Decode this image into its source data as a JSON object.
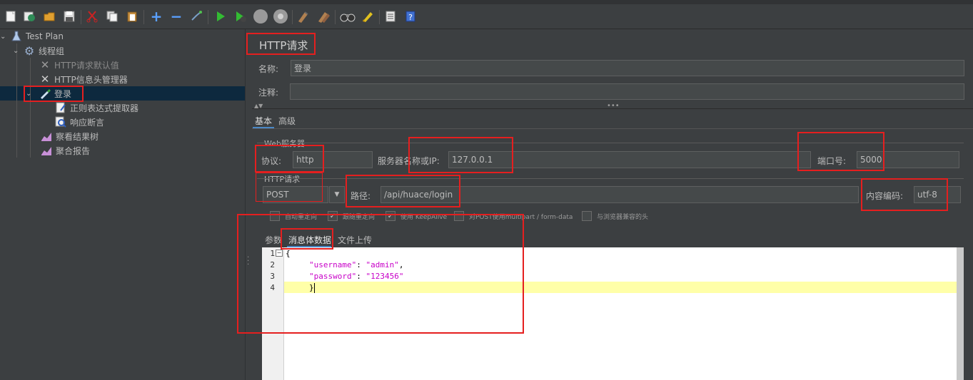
{
  "toolbar": {
    "icons": [
      "new-icon",
      "templates-icon",
      "open-icon",
      "save-icon",
      "cut-icon",
      "copy-icon",
      "paste-icon",
      "expand-icon",
      "collapse-icon",
      "toggle-icon",
      "start-icon",
      "start-no-pauses-icon",
      "stop-icon",
      "shutdown-icon",
      "clear-icon",
      "clear-all-icon",
      "search-icon",
      "reset-search-icon",
      "function-helper-icon",
      "help-icon"
    ]
  },
  "tree": {
    "root": "Test Plan",
    "thread_group": "线程组",
    "http_defaults": "HTTP请求默认值",
    "header_manager": "HTTP信息头管理器",
    "login": "登录",
    "regex_extractor": "正则表达式提取器",
    "response_assertion": "响应断言",
    "results_tree": "察看结果树",
    "aggregate_report": "聚合报告"
  },
  "panel": {
    "title": "HTTP请求",
    "name_label": "名称:",
    "name_value": "登录",
    "comment_label": "注释:",
    "comment_value": "",
    "tabs": [
      "基本",
      "高级"
    ],
    "web_server_title": "Web服务器",
    "protocol_label": "协议:",
    "protocol_value": "http",
    "server_label": "服务器名称或IP:",
    "server_value": "127.0.0.1",
    "port_label": "端口号:",
    "port_value": "5000",
    "http_request_title": "HTTP请求",
    "method_value": "POST",
    "path_label": "路径:",
    "path_value": "/api/huace/login",
    "encoding_label": "内容编码:",
    "encoding_value": "utf-8",
    "checkboxes": [
      {
        "label": "自动重定向",
        "checked": false
      },
      {
        "label": "跟随重定向",
        "checked": true
      },
      {
        "label": "使用 KeepAlive",
        "checked": true
      },
      {
        "label": "对POST使用multipart / form-data",
        "checked": false
      },
      {
        "label": "与浏览器兼容的头",
        "checked": false
      }
    ],
    "body_tabs": [
      "参数",
      "消息体数据",
      "文件上传"
    ]
  },
  "editor": {
    "line_numbers": [
      "1",
      "2",
      "3",
      "4"
    ],
    "brace_open": "{",
    "key1": "\"username\"",
    "val1": "\"admin\"",
    "key2": "\"password\"",
    "val2": "\"123456\"",
    "brace_close": "}"
  },
  "colors": {
    "background": "#3c3f41",
    "selection": "#0d293e",
    "annotation_red": "#e51f1f",
    "json_key": "#c800c8",
    "json_value": "#c800c8",
    "current_line": "#ffffa8"
  }
}
